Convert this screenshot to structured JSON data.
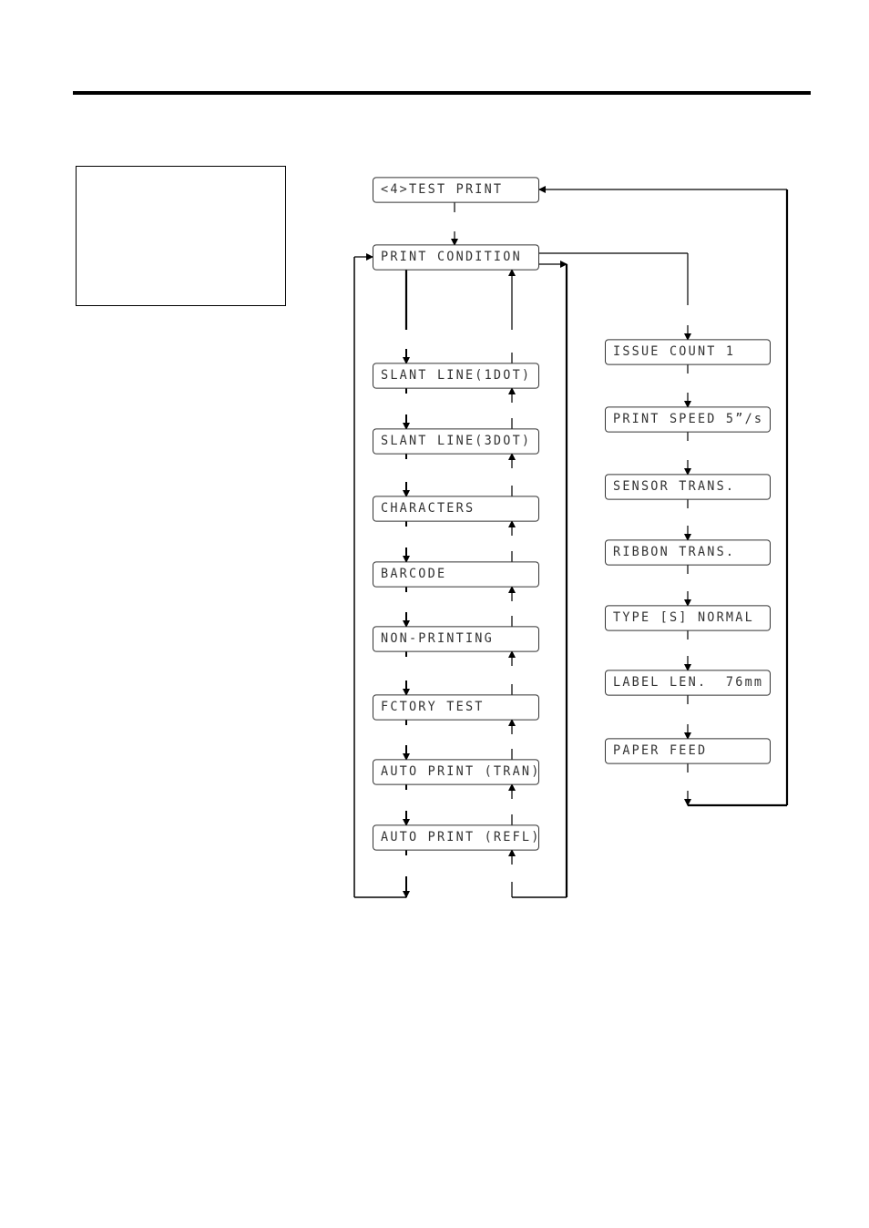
{
  "document": {
    "header_rule": true,
    "note_box_text": ""
  },
  "flowchart": {
    "top": {
      "label": "<4>TEST PRINT"
    },
    "condition": {
      "label": "PRINT CONDITION"
    },
    "left_items": [
      {
        "label": "SLANT LINE(1DOT)"
      },
      {
        "label": "SLANT LINE(3DOT)"
      },
      {
        "label": "CHARACTERS"
      },
      {
        "label": "BARCODE"
      },
      {
        "label": "NON-PRINTING"
      },
      {
        "label": "FCTORY TEST"
      },
      {
        "label": "AUTO PRINT (TRAN)"
      },
      {
        "label": "AUTO PRINT (REFL)"
      }
    ],
    "right_items": [
      {
        "label": "ISSUE COUNT 1"
      },
      {
        "label": "PRINT SPEED 5”/s"
      },
      {
        "label": "SENSOR TRANS."
      },
      {
        "label": "RIBBON TRANS."
      },
      {
        "label": "TYPE [S] NORMAL"
      },
      {
        "label": "LABEL LEN.  76mm"
      },
      {
        "label": "PAPER FEED"
      }
    ]
  }
}
